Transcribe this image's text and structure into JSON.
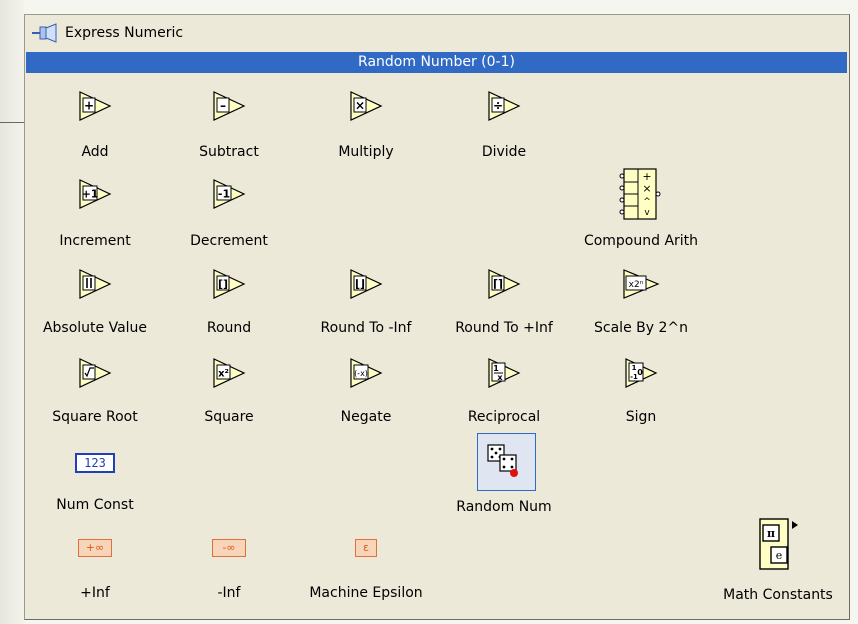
{
  "palette": {
    "title": "Express Numeric",
    "selected_label": "Random Number (0-1)"
  },
  "items": {
    "add": "Add",
    "subtract": "Subtract",
    "multiply": "Multiply",
    "divide": "Divide",
    "increment": "Increment",
    "decrement": "Decrement",
    "compound_arith": "Compound Arith",
    "absolute_value": "Absolute Value",
    "round": "Round",
    "round_to_neg_inf": "Round To -Inf",
    "round_to_pos_inf": "Round To +Inf",
    "scale_by_2n": "Scale By 2^n",
    "square_root": "Square Root",
    "square": "Square",
    "negate": "Negate",
    "reciprocal": "Reciprocal",
    "sign": "Sign",
    "num_const": "Num Const",
    "random_num": "Random Num",
    "pos_inf": "+Inf",
    "neg_inf": "-Inf",
    "machine_epsilon": "Machine Epsilon",
    "math_constants": "Math Constants"
  },
  "glyphs": {
    "num_const": "123",
    "pos_inf": "+∞",
    "neg_inf": "-∞",
    "machine_epsilon": "ε",
    "pi": "π",
    "e": "e"
  },
  "colors": {
    "selection": "#316ac5",
    "icon_fill": "#ffffc4",
    "constant_orange": "#e0703a",
    "num_const_blue": "#1f3fb8"
  }
}
